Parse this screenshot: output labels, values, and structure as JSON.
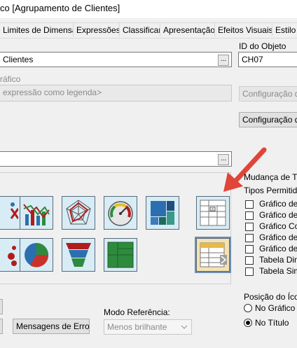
{
  "window": {
    "title": "co [Agrupamento de Clientes]"
  },
  "tabs": [
    {
      "label": "Limites de Dimensão"
    },
    {
      "label": "Expressões"
    },
    {
      "label": "Classificar"
    },
    {
      "label": "Apresentação"
    },
    {
      "label": "Efeitos Visuais"
    },
    {
      "label": "Estilo"
    }
  ],
  "object_id": {
    "label": "ID do Objeto",
    "value": "CH07"
  },
  "title_field": {
    "value": "Clientes",
    "browse_label": "..."
  },
  "subtitle": {
    "label": "ráfico",
    "placeholder": "expressão como legenda>"
  },
  "expression_field": {
    "browse_label": "..."
  },
  "buttons": {
    "config_disabled": "Configuração d",
    "config": "Configuração de",
    "error_messages": "Mensagens de Erro..."
  },
  "chart_types": [
    {
      "name": "scatter-plot"
    },
    {
      "name": "line-chart"
    },
    {
      "name": "radar-chart"
    },
    {
      "name": "gauge-chart"
    },
    {
      "name": "block-chart"
    },
    {
      "name": "pivot-table"
    },
    {
      "name": "mekko-chart"
    },
    {
      "name": "pie-chart"
    },
    {
      "name": "funnel-chart"
    },
    {
      "name": "grid-chart"
    },
    {
      "name": "straight-table"
    }
  ],
  "quick_change": {
    "label": "Mudança de Tip",
    "allowed_label": "Tipos Permitidos",
    "items": [
      {
        "label": "Gráfico de B",
        "checked": false
      },
      {
        "label": "Gráfico de L",
        "checked": false
      },
      {
        "label": "Gráfico Com",
        "checked": false
      },
      {
        "label": "Gráfico de D",
        "checked": false
      },
      {
        "label": "Gráfico de F",
        "checked": false
      },
      {
        "label": "Tabela Dinâ",
        "checked": false
      },
      {
        "label": "Tabela Simp",
        "checked": false
      }
    ]
  },
  "icon_position": {
    "label": "Posição do Ícon",
    "options": [
      {
        "label": "No Gráfico",
        "selected": false
      },
      {
        "label": "No Título",
        "selected": true
      }
    ]
  },
  "reference_mode": {
    "label": "Modo Referência:",
    "value": "Menos brilhante"
  },
  "colors": {
    "arrow": "#e0453a",
    "icon_bg": "#d8ecf5",
    "selected_bg": "#f4e3b0"
  }
}
